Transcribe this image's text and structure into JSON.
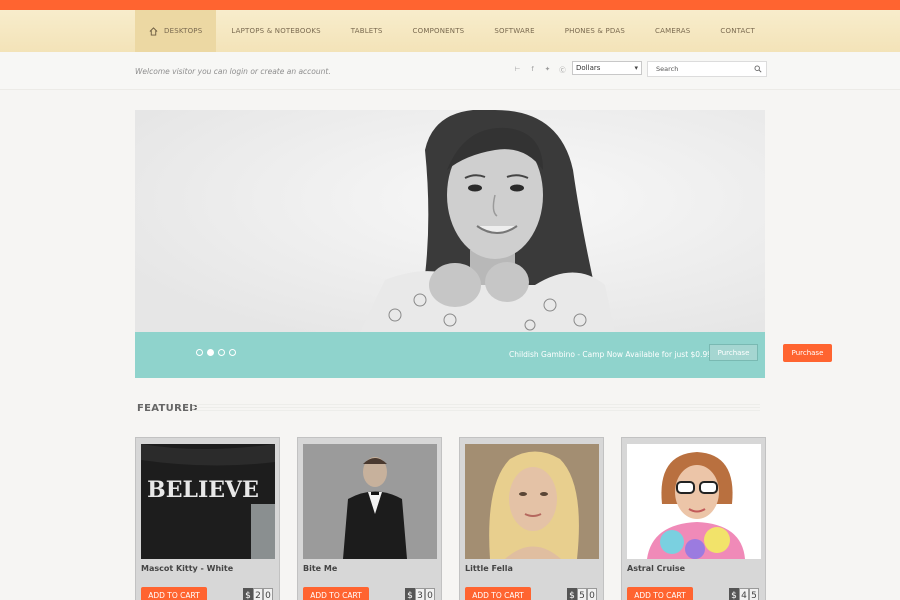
{
  "nav": {
    "items": [
      "DESKTOPS",
      "LAPTOPS & NOTEBOOKS",
      "TABLETS",
      "COMPONENTS",
      "SOFTWARE",
      "PHONES & PDAS",
      "CAMERAS",
      "CONTACT"
    ]
  },
  "subheader": {
    "welcome": "Welcome visitor you can login or create an account.",
    "social_icons": [
      "rss-icon",
      "facebook-icon",
      "twitter-icon",
      "skype-icon"
    ],
    "currency": "Dollars",
    "search_placeholder": "Search"
  },
  "slider": {
    "caption": "Childish Gambino - Camp Now Available for just $0.99",
    "button": "Purchase",
    "dots": 4,
    "active_dot": 1
  },
  "side_button": "Purchase",
  "featured": {
    "title": "FEATURED",
    "products": [
      {
        "name": "Mascot Kitty - White",
        "cart": "ADD TO CART",
        "currency": "$",
        "price": "20",
        "shirt_text": "BELIEVE"
      },
      {
        "name": "Bite Me",
        "cart": "ADD TO CART",
        "currency": "$",
        "price": "30"
      },
      {
        "name": "Little Fella",
        "cart": "ADD TO CART",
        "currency": "$",
        "price": "50"
      },
      {
        "name": "Astral Cruise",
        "cart": "ADD TO CART",
        "currency": "$",
        "price": "45"
      }
    ]
  },
  "colors": {
    "accent": "#ff6430",
    "teal": "#8fd3cc",
    "nav_bg": "#f3e3b8"
  }
}
